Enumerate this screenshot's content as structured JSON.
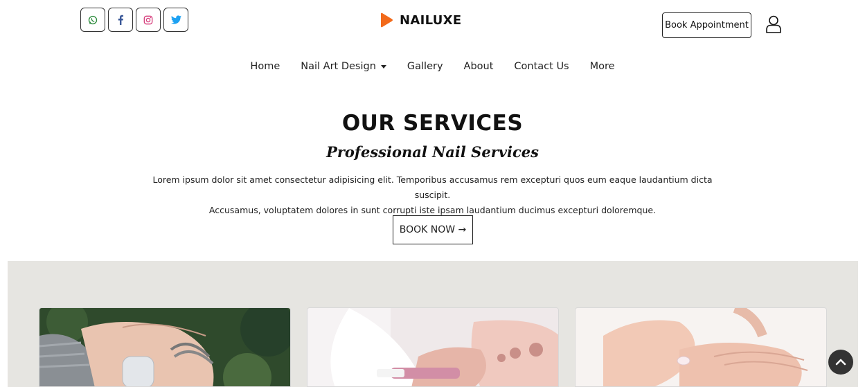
{
  "header": {
    "brand": "NAILUXE",
    "book_appointment": "Book Appointment",
    "social": [
      "whatsapp-icon",
      "facebook-icon",
      "instagram-icon",
      "twitter-icon"
    ]
  },
  "nav": {
    "items": [
      "Home",
      "Nail Art Design",
      "Gallery",
      "About",
      "Contact Us",
      "More"
    ]
  },
  "hero": {
    "title": "OUR SERVICES",
    "subtitle": "Professional Nail Services",
    "description_line1": "Lorem ipsum dolor sit amet consectetur adipisicing elit. Temporibus accusamus rem excepturi quos eum eaque laudantium dicta suscipit.",
    "description_line2": "Accusamus, voluptatem dolores in sunt corrupti iste ipsam laudantium ducimus excepturi doloremque.",
    "book_now": "BOOK NOW →"
  },
  "colors": {
    "brand_accent": "#f26a1b",
    "band_background": "#e6e5e1"
  }
}
